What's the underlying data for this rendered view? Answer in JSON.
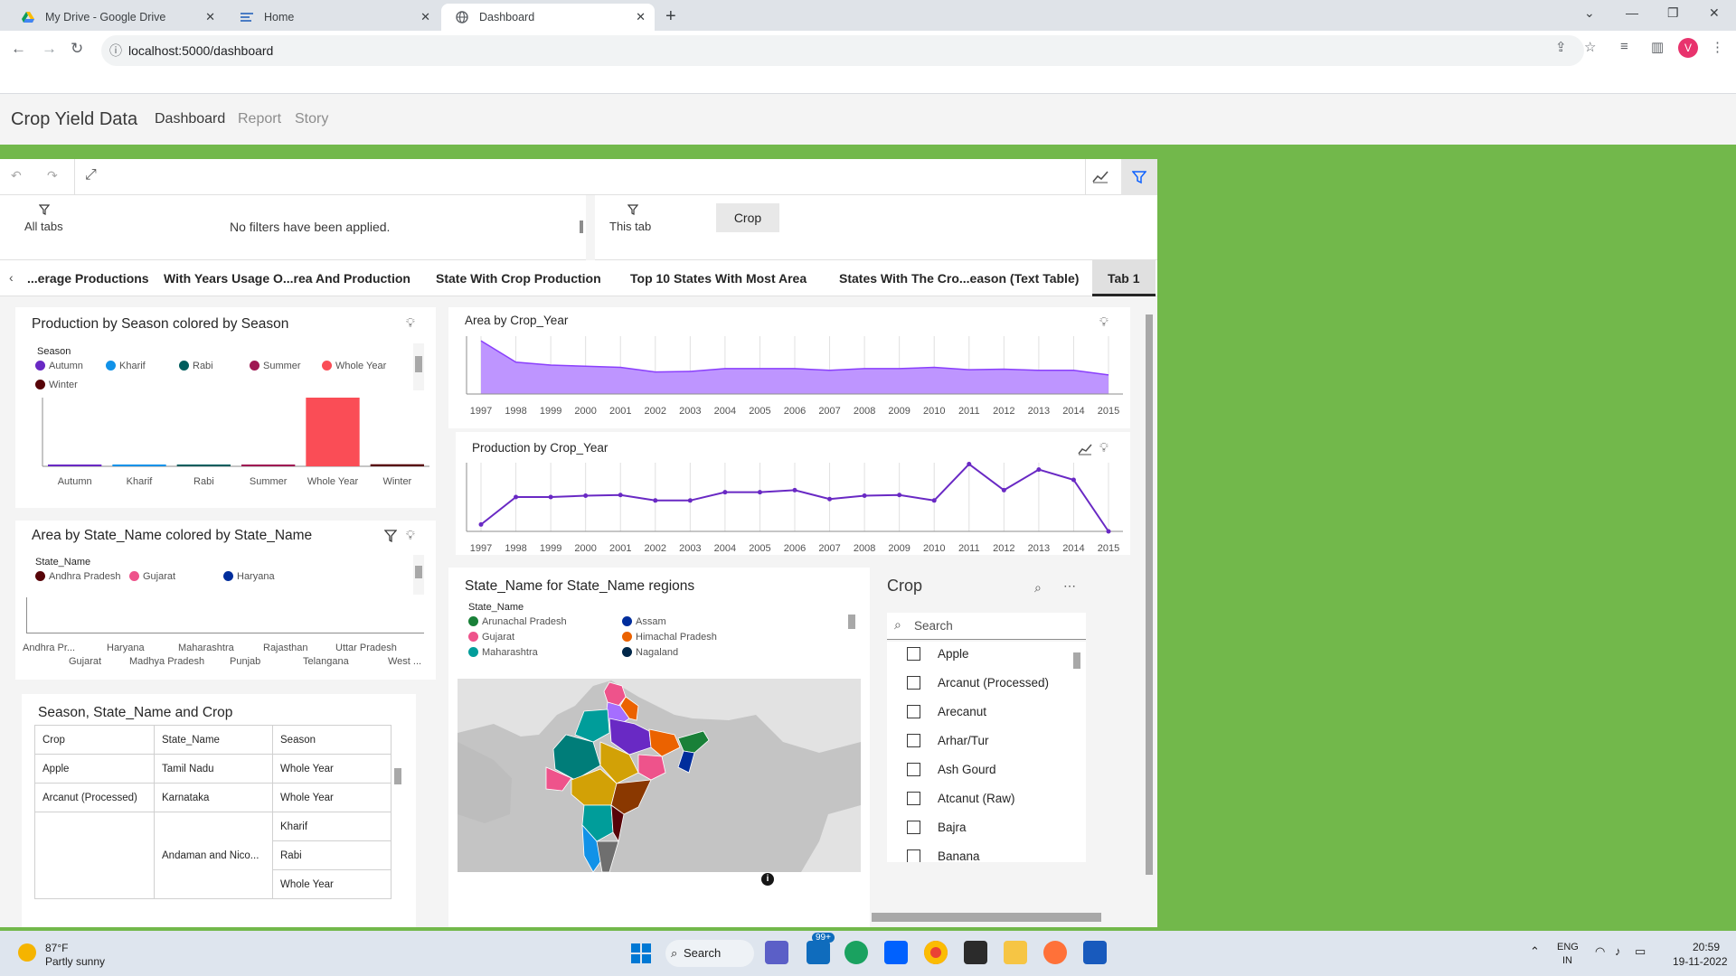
{
  "browser": {
    "tabs": [
      {
        "title": "My Drive - Google Drive",
        "active": false,
        "icon": "google-drive-icon"
      },
      {
        "title": "Home",
        "active": false,
        "icon": "home-page-icon"
      },
      {
        "title": "Dashboard",
        "active": true,
        "icon": "globe-icon"
      }
    ],
    "url": "localhost:5000/dashboard",
    "profile_initial": "V"
  },
  "app": {
    "title": "Crop Yield Data",
    "nav": [
      "Dashboard",
      "Report",
      "Story"
    ],
    "accent_color": "#72b84b"
  },
  "filters": {
    "all_tabs_label": "All tabs",
    "no_filters_text": "No filters have been applied.",
    "this_tab_label": "This tab",
    "crop_chip": "Crop"
  },
  "dash_tabs": [
    "...erage Productions",
    "With Years Usage O...rea And Production",
    "State With Crop Production",
    "Top 10 States With Most Area",
    "States With The Cro...eason (Text Table)",
    "Tab 1"
  ],
  "season_chart": {
    "title": "Production by Season colored by Season",
    "legend_title": "Season",
    "legend": [
      {
        "name": "Autumn",
        "color": "#6929c4"
      },
      {
        "name": "Kharif",
        "color": "#1192e8"
      },
      {
        "name": "Rabi",
        "color": "#005d5d"
      },
      {
        "name": "Summer",
        "color": "#9f1853"
      },
      {
        "name": "Whole Year",
        "color": "#fa4d56"
      },
      {
        "name": "Winter",
        "color": "#570408"
      }
    ]
  },
  "state_chart": {
    "title": "Area by State_Name colored by State_Name",
    "legend_title": "State_Name",
    "legend": [
      {
        "name": "Andhra Pradesh",
        "color": "#570408"
      },
      {
        "name": "Gujarat",
        "color": "#ee538b"
      },
      {
        "name": "Haryana",
        "color": "#002d9c"
      }
    ],
    "ticks_top": [
      "Andhra Pr...",
      "Haryana",
      "Maharashtra",
      "Rajasthan",
      "Uttar Pradesh"
    ],
    "ticks_bottom": [
      "Gujarat",
      "Madhya Pradesh",
      "Punjab",
      "Telangana",
      "West ..."
    ]
  },
  "table_card": {
    "title": "Season, State_Name and Crop",
    "headers": [
      "Crop",
      "State_Name",
      "Season"
    ],
    "rows": [
      {
        "crop": "Apple",
        "state": "Tamil Nadu",
        "season": "Whole Year"
      },
      {
        "crop": "Arcanut (Processed)",
        "state": "Karnataka",
        "season": "Whole Year"
      },
      {
        "crop": "",
        "state": "Andaman and Nico...",
        "season": "Kharif"
      },
      {
        "crop": "",
        "state": "",
        "season": "Rabi"
      },
      {
        "crop": "",
        "state": "",
        "season": "Whole Year"
      }
    ]
  },
  "area_chart_title": "Area by Crop_Year",
  "production_chart_title": "Production by Crop_Year",
  "map_card": {
    "title": "State_Name for State_Name regions",
    "legend_title": "State_Name",
    "legend": [
      {
        "name": "Arunachal Pradesh",
        "color": "#198038"
      },
      {
        "name": "Assam",
        "color": "#002d9c"
      },
      {
        "name": "Gujarat",
        "color": "#ee538b"
      },
      {
        "name": "Himachal Pradesh",
        "color": "#eb6200"
      },
      {
        "name": "Maharashtra",
        "color": "#009d9a"
      },
      {
        "name": "Nagaland",
        "color": "#012749"
      }
    ]
  },
  "crop_filter": {
    "title": "Crop",
    "search_placeholder": "Search",
    "items": [
      "Apple",
      "Arcanut (Processed)",
      "Arecanut",
      "Arhar/Tur",
      "Ash Gourd",
      "Atcanut (Raw)",
      "Bajra",
      "Banana"
    ]
  },
  "chart_data": [
    {
      "type": "bar",
      "title": "Production by Season colored by Season",
      "categories": [
        "Autumn",
        "Kharif",
        "Rabi",
        "Summer",
        "Whole Year",
        "Winter"
      ],
      "values": [
        0.2,
        1.5,
        1.2,
        0.4,
        100,
        3
      ],
      "colors": [
        "#6929c4",
        "#1192e8",
        "#005d5d",
        "#9f1853",
        "#fa4d56",
        "#570408"
      ],
      "ylim": [
        0,
        100
      ]
    },
    {
      "type": "area",
      "title": "Area by Crop_Year",
      "x": [
        1997,
        1998,
        1999,
        2000,
        2001,
        2002,
        2003,
        2004,
        2005,
        2006,
        2007,
        2008,
        2009,
        2010,
        2011,
        2012,
        2013,
        2014,
        2015
      ],
      "values": [
        92,
        55,
        50,
        48,
        46,
        38,
        39,
        44,
        44,
        44,
        41,
        44,
        44,
        46,
        42,
        43,
        41,
        41,
        33
      ],
      "ylim": [
        0,
        100
      ],
      "color": "#8a3ffc"
    },
    {
      "type": "line",
      "title": "Production by Crop_Year",
      "x": [
        1997,
        1998,
        1999,
        2000,
        2001,
        2002,
        2003,
        2004,
        2005,
        2006,
        2007,
        2008,
        2009,
        2010,
        2011,
        2012,
        2013,
        2014,
        2015
      ],
      "values": [
        10,
        50,
        50,
        52,
        53,
        45,
        45,
        57,
        57,
        60,
        47,
        52,
        53,
        45,
        98,
        60,
        90,
        75,
        0
      ],
      "ylim": [
        0,
        100
      ],
      "color": "#6929c4"
    }
  ],
  "taskbar": {
    "temp": "87°F",
    "weather": "Partly sunny",
    "search_label": "Search",
    "mail_badge": "99+",
    "lang1": "ENG",
    "lang2": "IN",
    "time": "20:59",
    "date": "19-11-2022"
  }
}
